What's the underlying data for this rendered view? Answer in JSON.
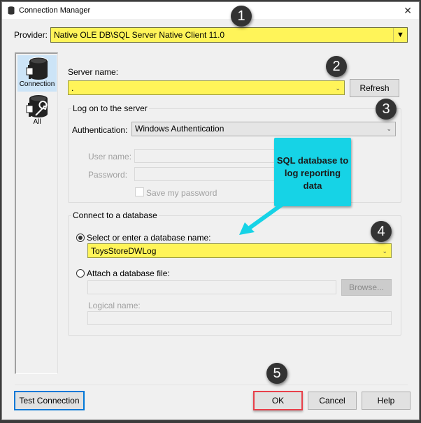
{
  "window": {
    "title": "Connection Manager",
    "close_icon": "close-icon"
  },
  "provider": {
    "label": "Provider:",
    "value": "Native OLE DB\\SQL Server Native Client 11.0"
  },
  "sidebar": {
    "items": [
      {
        "label": "Connection",
        "icon": "database-plug-icon",
        "selected": true
      },
      {
        "label": "All",
        "icon": "database-plug-wrench-icon",
        "selected": false
      }
    ]
  },
  "server": {
    "label": "Server name:",
    "value": ".",
    "refresh_label": "Refresh"
  },
  "logon": {
    "group_title": "Log on to the server",
    "auth_label": "Authentication:",
    "auth_value": "Windows Authentication",
    "username_label": "User name:",
    "username_value": "",
    "password_label": "Password:",
    "password_value": "",
    "save_password_label": "Save my password",
    "save_password_checked": false
  },
  "database": {
    "group_title": "Connect to a database",
    "select_option_label": "Select or enter a database name:",
    "select_option_checked": true,
    "database_name": "ToysStoreDWLog",
    "attach_option_label": "Attach a database file:",
    "attach_option_checked": false,
    "attach_file_value": "",
    "browse_label": "Browse...",
    "logical_name_label": "Logical name:",
    "logical_name_value": ""
  },
  "callout": {
    "lines": [
      "SQL database to",
      "log reporting",
      "data"
    ],
    "color": "#16d3e6"
  },
  "badges": [
    "1",
    "2",
    "3",
    "4",
    "5"
  ],
  "footer": {
    "test_connection_label": "Test Connection",
    "ok_label": "OK",
    "cancel_label": "Cancel",
    "help_label": "Help"
  },
  "colors": {
    "highlight_yellow": "#fff459",
    "ok_highlight_border": "#e8404a",
    "focus_blue": "#0078d7",
    "selected_sidebar": "#cce4f7"
  }
}
